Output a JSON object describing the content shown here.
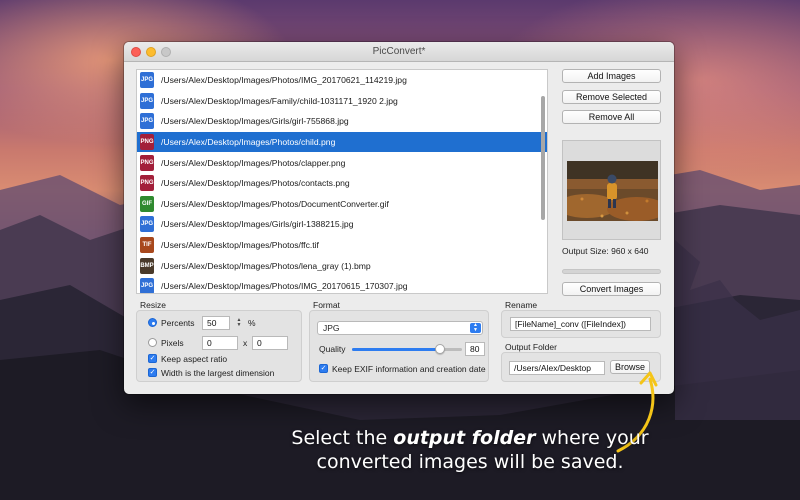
{
  "window": {
    "title": "PicConvert*"
  },
  "files": [
    {
      "type": "JPG",
      "path": "/Users/Alex/Desktop/Images/Photos/IMG_20170621_114219.jpg",
      "selected": false
    },
    {
      "type": "JPG",
      "path": "/Users/Alex/Desktop/Images/Family/child-1031171_1920 2.jpg",
      "selected": false
    },
    {
      "type": "JPG",
      "path": "/Users/Alex/Desktop/Images/Girls/girl-755868.jpg",
      "selected": false
    },
    {
      "type": "PNG",
      "path": "/Users/Alex/Desktop/Images/Photos/child.png",
      "selected": true
    },
    {
      "type": "PNG",
      "path": "/Users/Alex/Desktop/Images/Photos/clapper.png",
      "selected": false
    },
    {
      "type": "PNG",
      "path": "/Users/Alex/Desktop/Images/Photos/contacts.png",
      "selected": false
    },
    {
      "type": "GIF",
      "path": "/Users/Alex/Desktop/Images/Photos/DocumentConverter.gif",
      "selected": false
    },
    {
      "type": "JPG",
      "path": "/Users/Alex/Desktop/Images/Girls/girl-1388215.jpg",
      "selected": false
    },
    {
      "type": "TIF",
      "path": "/Users/Alex/Desktop/Images/Photos/ffc.tif",
      "selected": false
    },
    {
      "type": "BMP",
      "path": "/Users/Alex/Desktop/Images/Photos/lena_gray (1).bmp",
      "selected": false
    },
    {
      "type": "JPG",
      "path": "/Users/Alex/Desktop/Images/Photos/IMG_20170615_170307.jpg",
      "selected": false
    }
  ],
  "badge_colors": {
    "JPG": "#2f6fd6",
    "PNG": "#a3203a",
    "GIF": "#2f8a2f",
    "TIF": "#a8481c",
    "BMP": "#4a3a2a",
    "selected": "#1f6fd0"
  },
  "actions": {
    "add_label": "Add Images",
    "remove_selected_label": "Remove Selected",
    "remove_all_label": "Remove All",
    "convert_label": "Convert Images"
  },
  "preview": {
    "output_size": "Output Size: 960 x 640"
  },
  "resize": {
    "label": "Resize",
    "percents_label": "Percents",
    "percent_value": "50",
    "percent_unit": "%",
    "pixels_label": "Pixels",
    "width_value": "0",
    "x_label": "x",
    "height_value": "0",
    "keep_aspect_label": "Keep aspect ratio",
    "width_largest_label": "Width is the largest dimension"
  },
  "format": {
    "label": "Format",
    "selected": "JPG",
    "quality_label": "Quality",
    "quality_value": "80",
    "quality_fraction": 0.8,
    "keep_exif_label": "Keep EXIF information and creation date"
  },
  "rename": {
    "label": "Rename",
    "pattern": "[FileName]_conv ([FileIndex])"
  },
  "output": {
    "label": "Output Folder",
    "path": "/Users/Alex/Desktop",
    "browse_label": "Browse"
  },
  "caption": {
    "before": "Select the ",
    "emphasis": "output folder",
    "after": " where your converted images will be saved."
  },
  "accent_color": "#f5c518"
}
